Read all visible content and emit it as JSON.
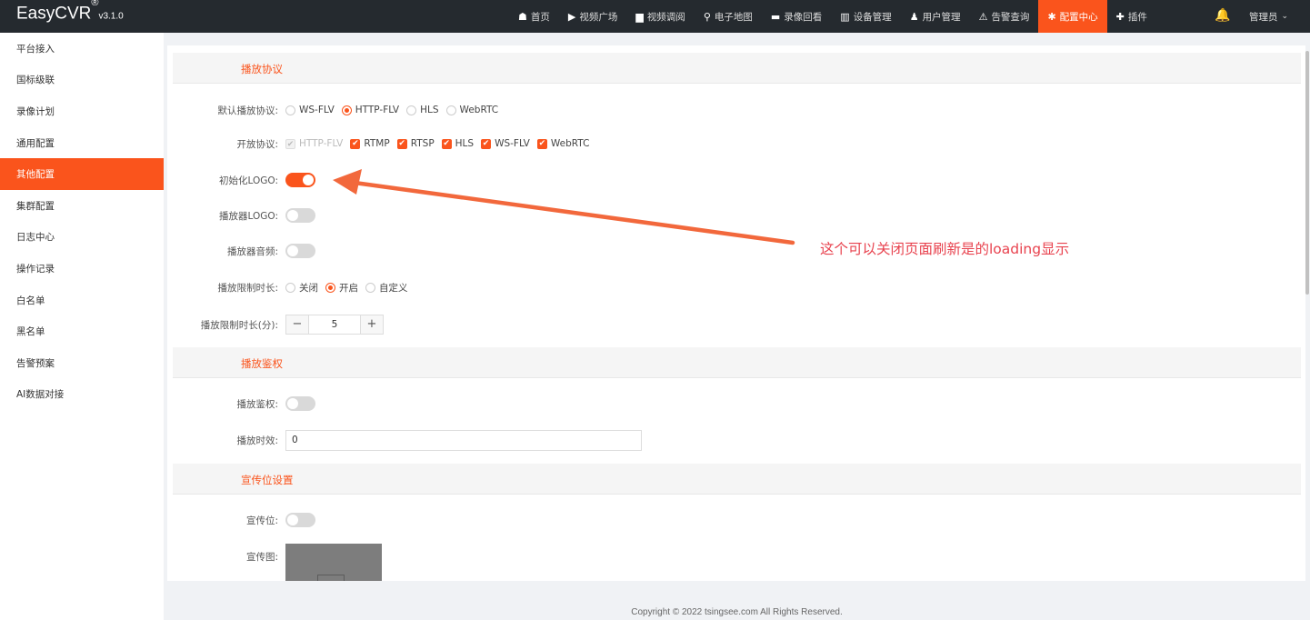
{
  "app": {
    "name": "EasyCVR",
    "reg": "®",
    "version": "v3.1.0"
  },
  "nav": [
    {
      "icon": "☗",
      "label": "首页"
    },
    {
      "icon": "▶",
      "label": "视频广场"
    },
    {
      "icon": "▆",
      "label": "视频调阅"
    },
    {
      "icon": "⚲",
      "label": "电子地图"
    },
    {
      "icon": "▬",
      "label": "录像回看"
    },
    {
      "icon": "▥",
      "label": "设备管理"
    },
    {
      "icon": "♟",
      "label": "用户管理"
    },
    {
      "icon": "⚠",
      "label": "告警查询"
    },
    {
      "icon": "✱",
      "label": "配置中心"
    },
    {
      "icon": "✚",
      "label": "插件"
    }
  ],
  "nav_active_index": 8,
  "user": {
    "name": "管理员",
    "chevron": "⌄"
  },
  "bell_icon": "🔔",
  "sidebar": [
    "平台接入",
    "国标级联",
    "录像计划",
    "通用配置",
    "其他配置",
    "集群配置",
    "日志中心",
    "操作记录",
    "白名单",
    "黑名单",
    "告警预案",
    "AI数据对接"
  ],
  "sidebar_active_index": 4,
  "sections": {
    "playback": "播放协议",
    "auth": "播放鉴权",
    "promo": "宣传位设置"
  },
  "fields": {
    "default_protocol": {
      "label": "默认播放协议:",
      "options": [
        "WS-FLV",
        "HTTP-FLV",
        "HLS",
        "WebRTC"
      ],
      "selected": "HTTP-FLV"
    },
    "open_protocol": {
      "label": "开放协议:",
      "options": [
        "HTTP-FLV",
        "RTMP",
        "RTSP",
        "HLS",
        "WS-FLV",
        "WebRTC"
      ],
      "disabled": [
        "HTTP-FLV"
      ],
      "checkmark": "✔"
    },
    "init_logo": {
      "label": "初始化LOGO:",
      "on": true
    },
    "player_logo": {
      "label": "播放器LOGO:",
      "on": false
    },
    "player_audio": {
      "label": "播放器音频:",
      "on": false
    },
    "play_limit": {
      "label": "播放限制时长:",
      "options": [
        "关闭",
        "开启",
        "自定义"
      ],
      "selected": "开启"
    },
    "play_limit_minutes": {
      "label": "播放限制时长(分):",
      "value": "5",
      "minus": "−",
      "plus": "+"
    },
    "play_auth": {
      "label": "播放鉴权:",
      "on": false
    },
    "play_valid": {
      "label": "播放时效:",
      "value": "0"
    },
    "promo_switch": {
      "label": "宣传位:",
      "on": false
    },
    "promo_image": {
      "label": "宣传图:"
    }
  },
  "annotation": {
    "text": "这个可以关闭页面刷新是的loading显示",
    "color": "#e8424e"
  },
  "footer": "Copyright © 2022 tsingsee.com All Rights Reserved.",
  "colors": {
    "accent": "#fa541c",
    "topbar": "#252a2f"
  }
}
